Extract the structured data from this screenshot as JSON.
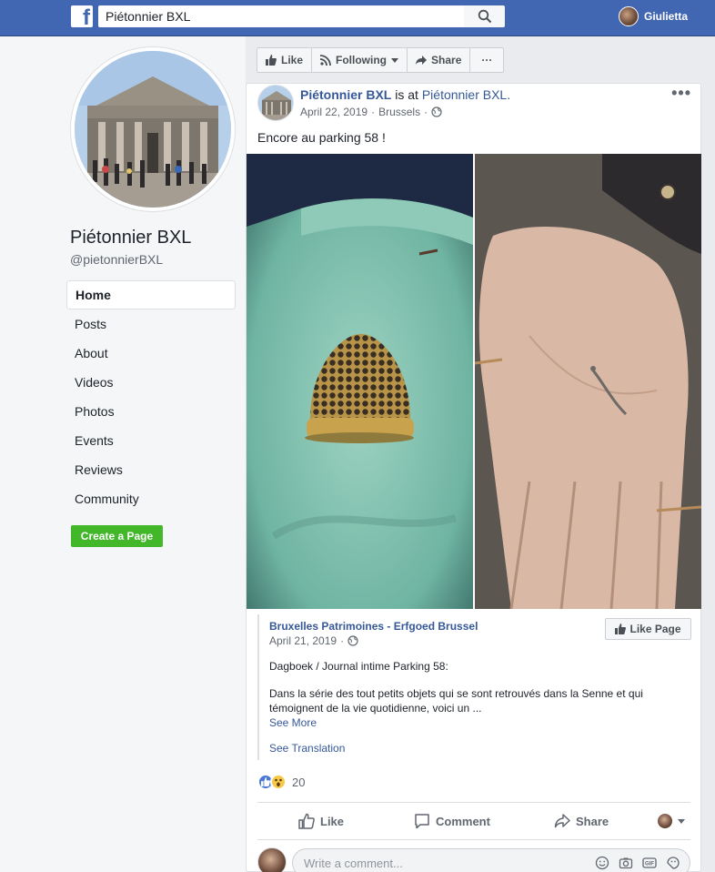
{
  "topbar": {
    "logo_letter": "f",
    "search_value": "Piétonnier BXL",
    "user_name": "Giulietta"
  },
  "page": {
    "name": "Piétonnier BXL",
    "handle": "@pietonnierBXL"
  },
  "nav": {
    "items": [
      {
        "label": "Home",
        "active": true
      },
      {
        "label": "Posts"
      },
      {
        "label": "About"
      },
      {
        "label": "Videos"
      },
      {
        "label": "Photos"
      },
      {
        "label": "Events"
      },
      {
        "label": "Reviews"
      },
      {
        "label": "Community"
      }
    ],
    "create_page": "Create a Page"
  },
  "actions": {
    "like": "Like",
    "following": "Following",
    "share": "Share",
    "more": "···"
  },
  "post": {
    "author": "Piétonnier BXL",
    "is_at": "is at",
    "location": "Piétonnier BXL.",
    "date": "April 22, 2019",
    "place": "Brussels",
    "text": "Encore au parking 58 !",
    "more": "•••",
    "shared": {
      "source": "Bruxelles Patrimoines - Erfgoed Brussel",
      "date": "April 21, 2019",
      "like_page": "Like Page",
      "para1": "Dagboek / Journal intime Parking 58:",
      "para2": "Dans la série des tout petits objets qui se sont retrouvés dans la Senne et qui témoignent de la vie quotidienne, voici un ...",
      "see_more": "See More",
      "see_translation": "See Translation"
    },
    "reaction_count": "20",
    "buttons": {
      "like": "Like",
      "comment": "Comment",
      "share": "Share"
    },
    "comment_placeholder": "Write a comment..."
  },
  "colors": {
    "brand": "#4267b2",
    "link": "#365899",
    "create_green": "#42b72a"
  }
}
